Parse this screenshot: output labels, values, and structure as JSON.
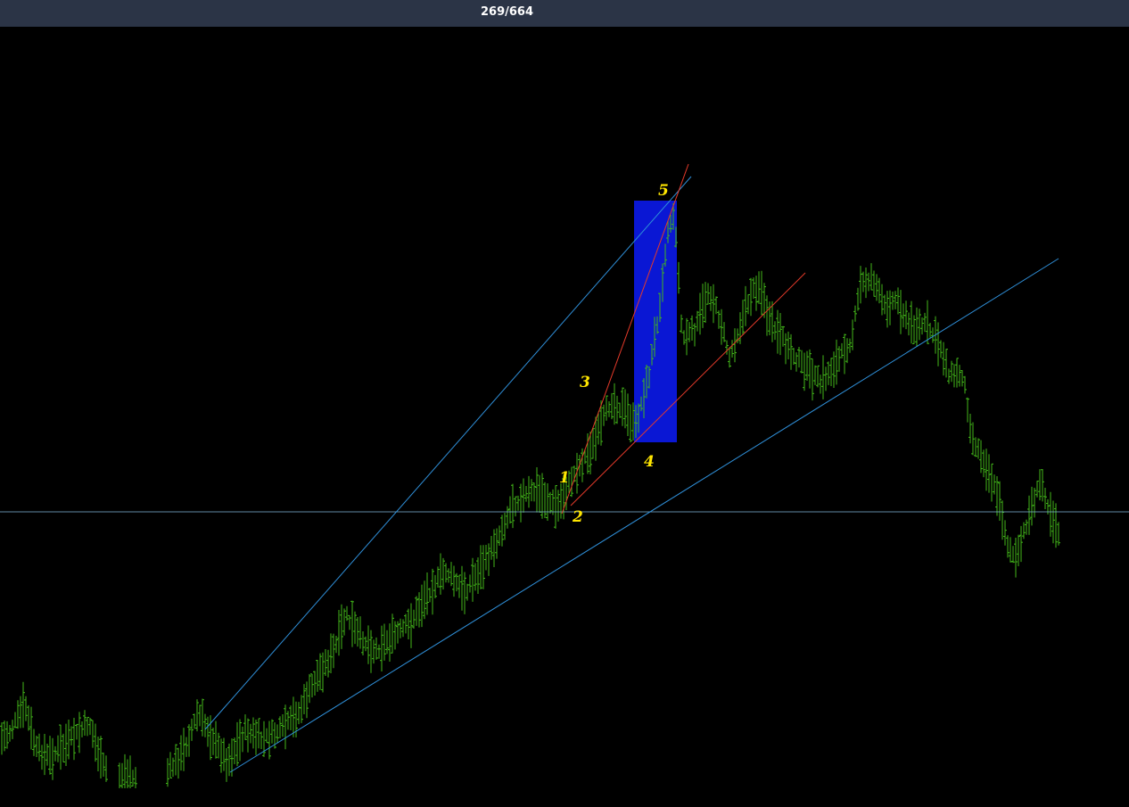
{
  "header": {
    "counter": "269/664"
  },
  "colors": {
    "background": "#000000",
    "header_bg": "#2b3446",
    "bar": "#43b91a",
    "trendline_blue": "#2f8fd8",
    "trendline_red": "#e43a2a",
    "highlight_box": "#0a17d4",
    "wave_label": "#ffe600",
    "horizontal_line": "#7fb7d8"
  },
  "chart_data": {
    "type": "ohlc",
    "grid": false,
    "legend": "none",
    "wave_labels": [
      "1",
      "2",
      "3",
      "4",
      "5"
    ]
  }
}
